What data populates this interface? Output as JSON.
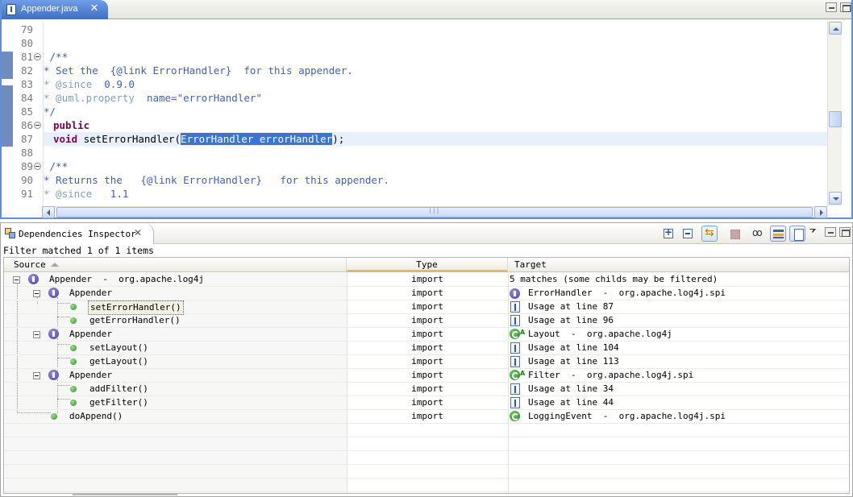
{
  "editor": {
    "tab_title": "Appender.java",
    "lines": [
      {
        "n": "79"
      },
      {
        "n": "80"
      },
      {
        "n": "81"
      },
      {
        "n": "82"
      },
      {
        "n": "83"
      },
      {
        "n": "84"
      },
      {
        "n": "85"
      },
      {
        "n": "86"
      },
      {
        "n": "87"
      },
      {
        "n": "88"
      },
      {
        "n": "89"
      },
      {
        "n": "90"
      },
      {
        "n": "91"
      }
    ],
    "code": {
      "l81": " /**",
      "l82": "* Set the  {@link ErrorHandler}  for this appender.",
      "l83_tag": "* @since",
      "l83_val": "  0.9.0",
      "l84_tag": "* @uml.property",
      "l84_val": "  name=\"errorHandler\"",
      "l85": "*/",
      "l86_kw": "public",
      "l87_kw": "void",
      "l87_pre": " setErrorHandler(",
      "l87_sel": "ErrorHandler errorHandler",
      "l87_post": ");",
      "l89": " /**",
      "l90": "* Returns the   {@link ErrorHandler}   for this appender.",
      "l91_tag": "* @since",
      "l91_val": "   1.1"
    }
  },
  "inspector": {
    "tab_title": "Dependencies Inspector",
    "filter_status": "Filter matched 1 of 1 items",
    "columns": {
      "source": "Source",
      "type": "Type",
      "target": "Target"
    },
    "rows": [
      {
        "source": "Appender  -  org.apache.log4j",
        "type": "import",
        "target": "5 matches (some childs may be filtered)"
      },
      {
        "source": "Appender",
        "type": "import",
        "target": "ErrorHandler  -  org.apache.log4j.spi"
      },
      {
        "source": "setErrorHandler()",
        "type": "import",
        "target": "Usage at line 87"
      },
      {
        "source": "getErrorHandler()",
        "type": "import",
        "target": "Usage at line 96"
      },
      {
        "source": "Appender",
        "type": "import",
        "target": "Layout  -  org.apache.log4j"
      },
      {
        "source": "setLayout()",
        "type": "import",
        "target": "Usage at line 104"
      },
      {
        "source": "getLayout()",
        "type": "import",
        "target": "Usage at line 113"
      },
      {
        "source": "Appender",
        "type": "import",
        "target": "Filter  -  org.apache.log4j.spi"
      },
      {
        "source": "addFilter()",
        "type": "import",
        "target": "Usage at line 34"
      },
      {
        "source": "getFilter()",
        "type": "import",
        "target": "Usage at line 44"
      },
      {
        "source": "doAppend()",
        "type": "import",
        "target": "LoggingEvent  -  org.apache.log4j.spi"
      }
    ]
  },
  "colors": {
    "keyword": "#7f0055",
    "javadoc": "#3f5fbf",
    "javadoc_tag": "#7f9fbf",
    "selection": "#3875d7",
    "active_tab": "#3f6fc6"
  }
}
